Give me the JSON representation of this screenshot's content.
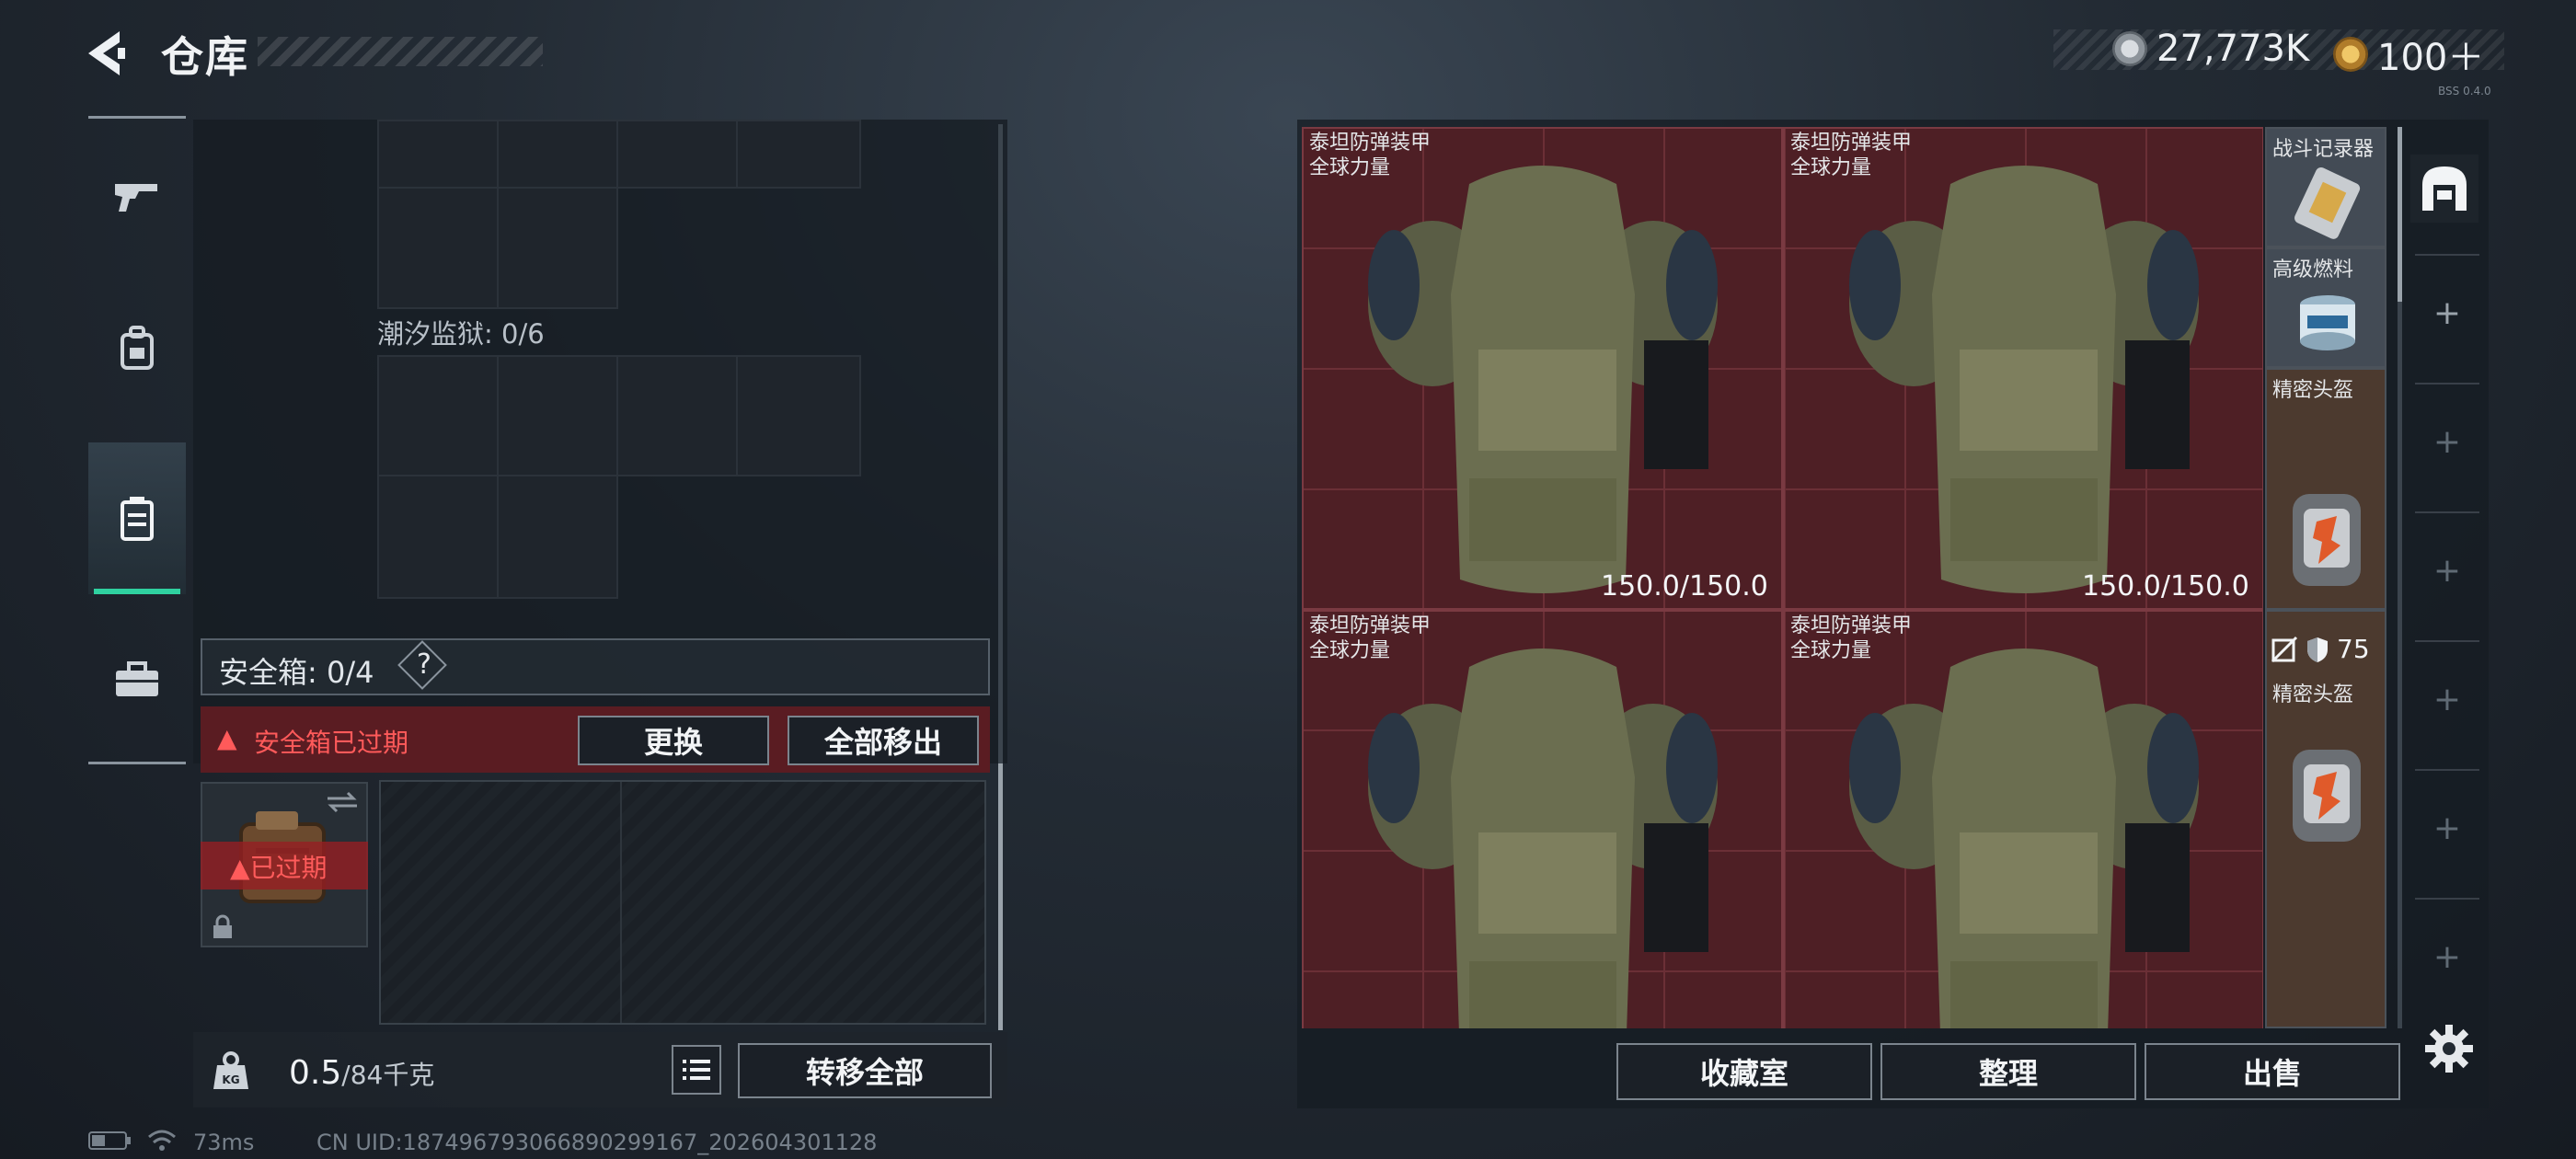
{
  "header": {
    "title": "仓库",
    "currency_silver": "27,773K",
    "currency_gold": "100＋",
    "version": "BSS 0.4.0"
  },
  "sidenav": {
    "items": [
      {
        "name": "weapons",
        "icon": "pistol-icon"
      },
      {
        "name": "backpack",
        "icon": "backpack-icon"
      },
      {
        "name": "case",
        "icon": "case-icon",
        "active": true
      },
      {
        "name": "toolbox",
        "icon": "briefcase-icon"
      }
    ]
  },
  "left": {
    "tide_prison_label": "潮汐监狱: 0/6",
    "safebox_label": "安全箱: 0/4",
    "help": "?",
    "expired_warning": "安全箱已过期",
    "replace_button": "更换",
    "move_all_out_button": "全部移出",
    "case_expired": "已过期",
    "weight_value": "0.5",
    "weight_max": "/84千克",
    "transfer_all_button": "转移全部"
  },
  "stash": {
    "armors": [
      {
        "name": "泰坦防弹装甲",
        "sub": "全球力量",
        "durability": "150.0/150.0"
      },
      {
        "name": "泰坦防弹装甲",
        "sub": "全球力量",
        "durability": "150.0/150.0"
      },
      {
        "name": "泰坦防弹装甲",
        "sub": "全球力量",
        "durability": ""
      },
      {
        "name": "泰坦防弹装甲",
        "sub": "全球力量",
        "durability": ""
      }
    ],
    "side_items": {
      "combat_recorder": "战斗记录器",
      "advanced_fuel": "高级燃料",
      "precision_helmet_1": "精密头盔",
      "armor_value": "75",
      "precision_helmet_2": "精密头盔"
    }
  },
  "bottom_actions": {
    "collection_room": "收藏室",
    "organize": "整理",
    "sell": "出售"
  },
  "status": {
    "ping": "73ms",
    "uid": "CN UID:18749679306689029916​7_202604301128"
  }
}
